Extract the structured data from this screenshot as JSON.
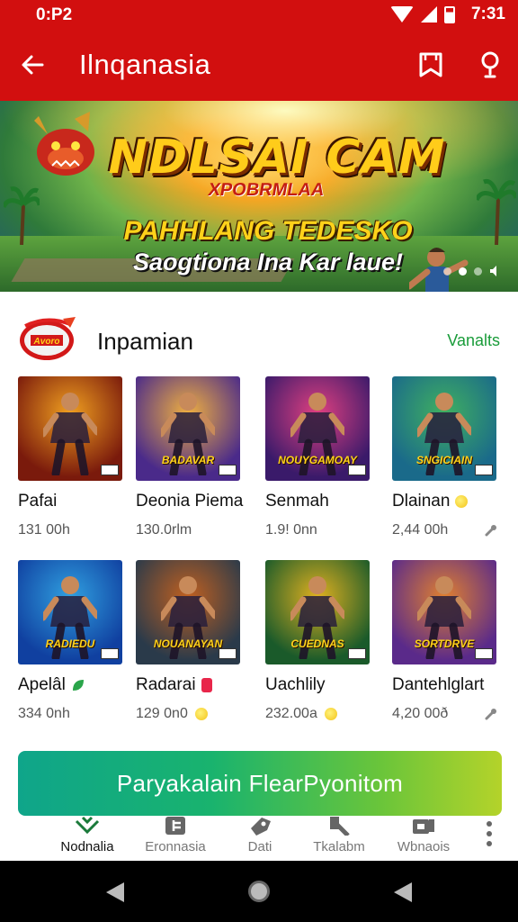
{
  "status_bar": {
    "time_left": "0:P2",
    "time_right": "7:31"
  },
  "app_bar": {
    "title": "Ilnqanasia"
  },
  "banner": {
    "title": "NDLSAI CAM",
    "subtitle_1": "XPOBRMLAA",
    "subtitle_2": "PAHHLANG TEDESKO",
    "subtitle_3": "Saogtiona Ina Kar laue!"
  },
  "section": {
    "title": "Inpamian",
    "action": "Vanalts",
    "logo_text": "Avoro"
  },
  "games": [
    {
      "name": "Pafai",
      "size": "131 00h",
      "thumb_text": "",
      "colors": [
        "#7a1a0c",
        "#f0a020"
      ],
      "trail": ""
    },
    {
      "name": "Deonia Piema",
      "size": "130.0rlm",
      "thumb_text": "BADAVAR",
      "colors": [
        "#4a2a8a",
        "#f0b040"
      ],
      "trail": ""
    },
    {
      "name": "Senmah",
      "size": "1.9! 0nn",
      "thumb_text": "NOUYGAMOAY",
      "colors": [
        "#3a1a6a",
        "#e04080"
      ],
      "trail": ""
    },
    {
      "name": "Dlainan",
      "size": "2,44 00h",
      "thumb_text": "SNGICIAIN",
      "colors": [
        "#1a6a8a",
        "#40b060"
      ],
      "trail": "coin",
      "size_trail": "wrench"
    },
    {
      "name": "Apelâl",
      "size": "334 0nh",
      "thumb_text": "RADIEDU",
      "colors": [
        "#1040a0",
        "#30a0e0"
      ],
      "trail": "leaf"
    },
    {
      "name": "Radarai",
      "size": "129 0n0",
      "thumb_text": "NOUANAYAN",
      "colors": [
        "#2a3a4a",
        "#c06020"
      ],
      "trail": "badge",
      "size_trail": "coin"
    },
    {
      "name": "Uachlily",
      "size": "232.00a",
      "thumb_text": "CUEDNAS",
      "colors": [
        "#1a5a2a",
        "#e0b020"
      ],
      "trail": "",
      "size_trail": "coin"
    },
    {
      "name": "Dantehlglart",
      "size": "4,20 00ð",
      "thumb_text": "SORTDRVE",
      "colors": [
        "#5a2a8a",
        "#e08030"
      ],
      "trail": "",
      "size_trail": "wrench"
    }
  ],
  "cta": {
    "label": "Paryakalain FlearPyonitom"
  },
  "bottom_nav": [
    {
      "label": "Nodnalia",
      "icon": "home-icon",
      "active": true
    },
    {
      "label": "Eronnasia",
      "icon": "grid-icon",
      "active": false
    },
    {
      "label": "Dati",
      "icon": "tag-icon",
      "active": false
    },
    {
      "label": "Tkalabm",
      "icon": "tools-icon",
      "active": false
    },
    {
      "label": "Wbnaois",
      "icon": "video-icon",
      "active": false
    }
  ]
}
